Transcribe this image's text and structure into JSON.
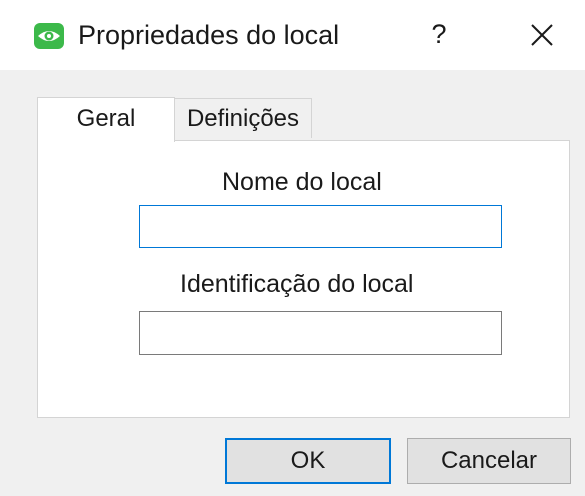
{
  "window": {
    "title": "Propriedades do local",
    "help_label": "?",
    "app_icon": "eye-icon",
    "close_icon": "close-icon",
    "accent_color": "#0078d7",
    "icon_color": "#3cb94a"
  },
  "tabs": [
    {
      "label": "Geral",
      "active": true
    },
    {
      "label": "Definições",
      "active": false
    }
  ],
  "form": {
    "site_name": {
      "label": "Nome do local",
      "value": ""
    },
    "site_id": {
      "label": "Identificação do local",
      "value": ""
    }
  },
  "buttons": {
    "ok_label": "OK",
    "cancel_label": "Cancelar"
  }
}
